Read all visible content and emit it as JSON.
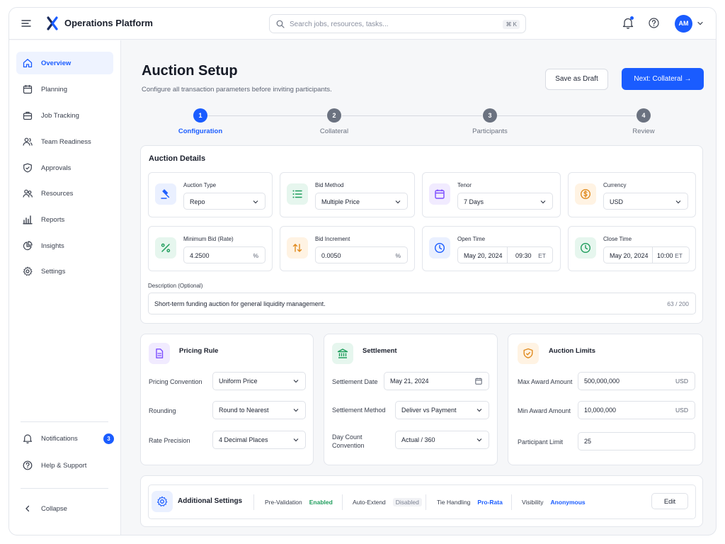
{
  "app": {
    "brand": "Operations Platform",
    "search_placeholder": "Search jobs, resources, tasks...",
    "search_shortcut": "⌘ K",
    "user_initials": "AM",
    "accent": "#1a5cff"
  },
  "sidebar": {
    "items": [
      {
        "label": "Overview",
        "icon": "home-icon",
        "active": true
      },
      {
        "label": "Planning",
        "icon": "calendar-icon"
      },
      {
        "label": "Job Tracking",
        "icon": "briefcase-icon"
      },
      {
        "label": "Team Readiness",
        "icon": "users-icon"
      },
      {
        "label": "Approvals",
        "icon": "shield-check-icon"
      },
      {
        "label": "Resources",
        "icon": "people-icon"
      },
      {
        "label": "Reports",
        "icon": "bar-chart-icon"
      },
      {
        "label": "Insights",
        "icon": "pie-chart-icon"
      },
      {
        "label": "Settings",
        "icon": "gear-icon"
      }
    ],
    "notifications_label": "Notifications",
    "notifications_count": "3",
    "help_label": "Help & Support",
    "collapse_label": "Collapse"
  },
  "page": {
    "title": "Auction Setup",
    "subtitle": "Configure all transaction parameters before inviting participants.",
    "save_draft": "Save as Draft",
    "next": "Next: Collateral →"
  },
  "stepper": [
    {
      "num": "1",
      "label": "Configuration",
      "active": true
    },
    {
      "num": "2",
      "label": "Collateral"
    },
    {
      "num": "3",
      "label": "Participants"
    },
    {
      "num": "4",
      "label": "Review"
    }
  ],
  "details": {
    "title": "Auction Details",
    "auction_type": {
      "label": "Auction Type",
      "value": "Repo"
    },
    "bid_method": {
      "label": "Bid Method",
      "value": "Multiple Price"
    },
    "tenor": {
      "label": "Tenor",
      "value": "7 Days"
    },
    "currency": {
      "label": "Currency",
      "value": "USD"
    },
    "min_bid": {
      "label": "Minimum Bid (Rate)",
      "value": "4.2500",
      "unit": "%"
    },
    "bid_increment": {
      "label": "Bid Increment",
      "value": "0.0050",
      "unit": "%"
    },
    "open_time": {
      "label": "Open Time",
      "date": "May 20, 2024",
      "time": "09:30",
      "tz": "ET"
    },
    "close_time": {
      "label": "Close Time",
      "date": "May 20, 2024",
      "time": "10:00",
      "tz": "ET"
    },
    "description_label": "Description (Optional)",
    "description": "Short-term funding auction for general liquidity management.",
    "description_count": "63 / 200"
  },
  "pricing": {
    "title": "Pricing Rule",
    "convention_label": "Pricing Convention",
    "convention_value": "Uniform Price",
    "rounding_label": "Rounding",
    "rounding_value": "Round to Nearest",
    "precision_label": "Rate Precision",
    "precision_value": "4 Decimal Places"
  },
  "settlement": {
    "title": "Settlement",
    "date_label": "Settlement Date",
    "date_value": "May 21, 2024",
    "method_label": "Settlement Method",
    "method_value": "Deliver vs Payment",
    "daycount_label_1": "Day Count",
    "daycount_label_2": "Convention",
    "daycount_value": "Actual / 360"
  },
  "limits": {
    "title": "Auction Limits",
    "max_label": "Max Award Amount",
    "max_value": "500,000,000",
    "max_unit": "USD",
    "min_label": "Min Award Amount",
    "min_value": "10,000,000",
    "min_unit": "USD",
    "participant_label": "Participant Limit",
    "participant_value": "25"
  },
  "additional": {
    "title": "Additional Settings",
    "prevalidation_label": "Pre-Validation",
    "prevalidation_value": "Enabled",
    "autoextend_label": "Auto-Extend",
    "autoextend_value": "Disabled",
    "tie_label": "Tie Handling",
    "tie_value": "Pro-Rata",
    "visibility_label": "Visibility",
    "visibility_value": "Anonymous",
    "edit": "Edit"
  }
}
